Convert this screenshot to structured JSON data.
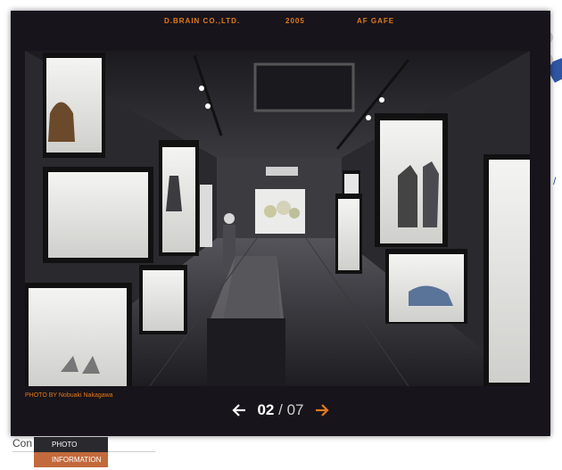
{
  "header": {
    "company": "D.BRAIN CO.,LTD.",
    "year": "2005",
    "project": "AF GAFE"
  },
  "photo": {
    "credit": "PHOTO BY Nobuaki Nakagawa"
  },
  "pager": {
    "current": "02",
    "separator": "/",
    "total": "07"
  },
  "menu": {
    "photo_label": "PHOTO",
    "info_label": "INFORMATION"
  },
  "background": {
    "field_label": "Con"
  },
  "colors": {
    "panel": "#18141b",
    "accent": "#e07a1c",
    "info_tab": "#c26a3c"
  }
}
